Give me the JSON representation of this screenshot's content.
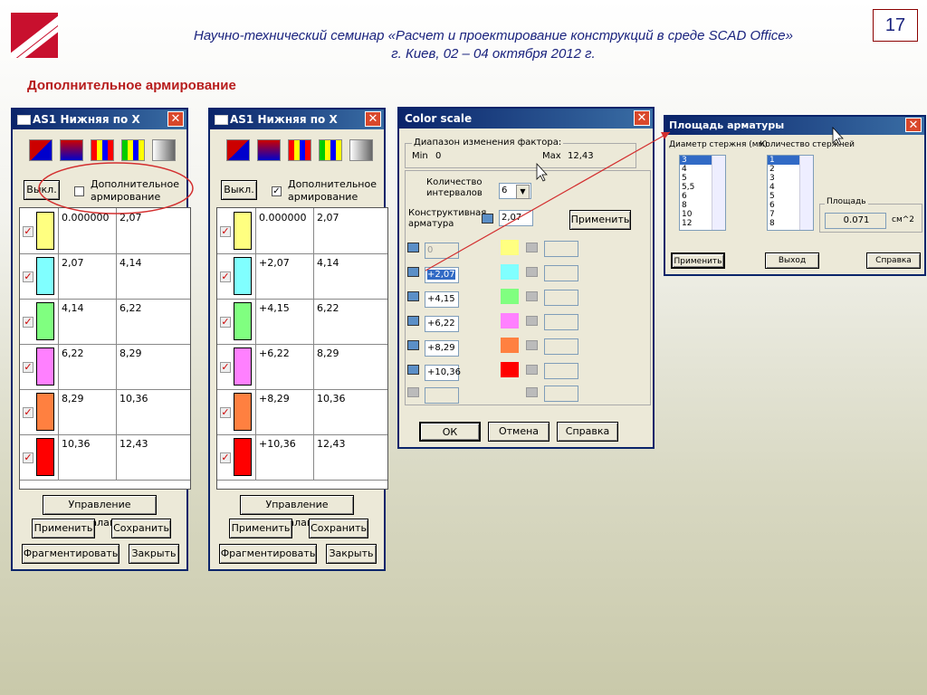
{
  "slide": {
    "header_line1": "Научно-технический семинар «Расчет и проектирование конструкций в среде SCAD Office»",
    "header_line2": "г. Киев, 02 – 04 октября 2012 г.",
    "number": "17",
    "section_title": "Дополнительное армирование"
  },
  "panel_left": {
    "title": "AS1 Нижняя по X",
    "off_button": "Выкл.",
    "checkbox_label_1": "Дополнительное",
    "checkbox_label_2": "армирование",
    "checked": false,
    "rows": [
      {
        "from": "0.000000",
        "to": "2,07",
        "color": "#ffff80"
      },
      {
        "from": "2,07",
        "to": "4,14",
        "color": "#80ffff"
      },
      {
        "from": "4,14",
        "to": "6,22",
        "color": "#80ff80"
      },
      {
        "from": "6,22",
        "to": "8,29",
        "color": "#ff80ff"
      },
      {
        "from": "8,29",
        "to": "10,36",
        "color": "#ff8040"
      },
      {
        "from": "10,36",
        "to": "12,43",
        "color": "#ff0000"
      }
    ],
    "scale_button": "Управление шкалами",
    "apply_button": "Применить",
    "save_button": "Сохранить",
    "fragment_button": "Фрагментировать",
    "close_button": "Закрыть"
  },
  "panel_right": {
    "title": "AS1 Нижняя по X",
    "off_button": "Выкл.",
    "checkbox_label_1": "Дополнительное",
    "checkbox_label_2": "армирование",
    "checked": true,
    "rows": [
      {
        "from": "0.000000",
        "to": "2,07",
        "color": "#ffff80"
      },
      {
        "from": "+2,07",
        "to": "4,14",
        "color": "#80ffff"
      },
      {
        "from": "+4,15",
        "to": "6,22",
        "color": "#80ff80"
      },
      {
        "from": "+6,22",
        "to": "8,29",
        "color": "#ff80ff"
      },
      {
        "from": "+8,29",
        "to": "10,36",
        "color": "#ff8040"
      },
      {
        "from": "+10,36",
        "to": "12,43",
        "color": "#ff0000"
      }
    ],
    "scale_button": "Управление шкалами",
    "apply_button": "Применить",
    "save_button": "Сохранить",
    "fragment_button": "Фрагментировать",
    "close_button": "Закрыть"
  },
  "color_scale": {
    "title": "Color scale",
    "range_label": "Диапазон изменения фактора:",
    "min_label": "Min",
    "min_value": "0",
    "max_label": "Max",
    "max_value": "12,43",
    "intervals_label_1": "Количество",
    "intervals_label_2": "интервалов",
    "intervals_value": "6",
    "constr_label_1": "Конструктивная",
    "constr_label_2": "арматура",
    "constr_value": "2,07",
    "apply_button": "Применить",
    "levels": [
      "0",
      "+2,07",
      "+4,15",
      "+6,22",
      "+8,29",
      "+10,36"
    ],
    "level_colors": [
      "#ffff80",
      "#80ffff",
      "#80ff80",
      "#ff80ff",
      "#ff8040",
      "#ff0000"
    ],
    "ok_button": "ОК",
    "cancel_button": "Отмена",
    "help_button": "Справка"
  },
  "area_dialog": {
    "title": "Площадь арматуры",
    "diameter_label": "Диаметр стержня (мм)",
    "count_label": "Количество стержней",
    "diameters": [
      "3",
      "4",
      "5",
      "5,5",
      "6",
      "8",
      "10",
      "12"
    ],
    "counts": [
      "1",
      "2",
      "3",
      "4",
      "5",
      "6",
      "7",
      "8"
    ],
    "area_group_label": "Площадь",
    "area_value": "0.071",
    "area_unit": "см^2",
    "apply_button": "Применить",
    "exit_button": "Выход",
    "help_button": "Справка"
  }
}
